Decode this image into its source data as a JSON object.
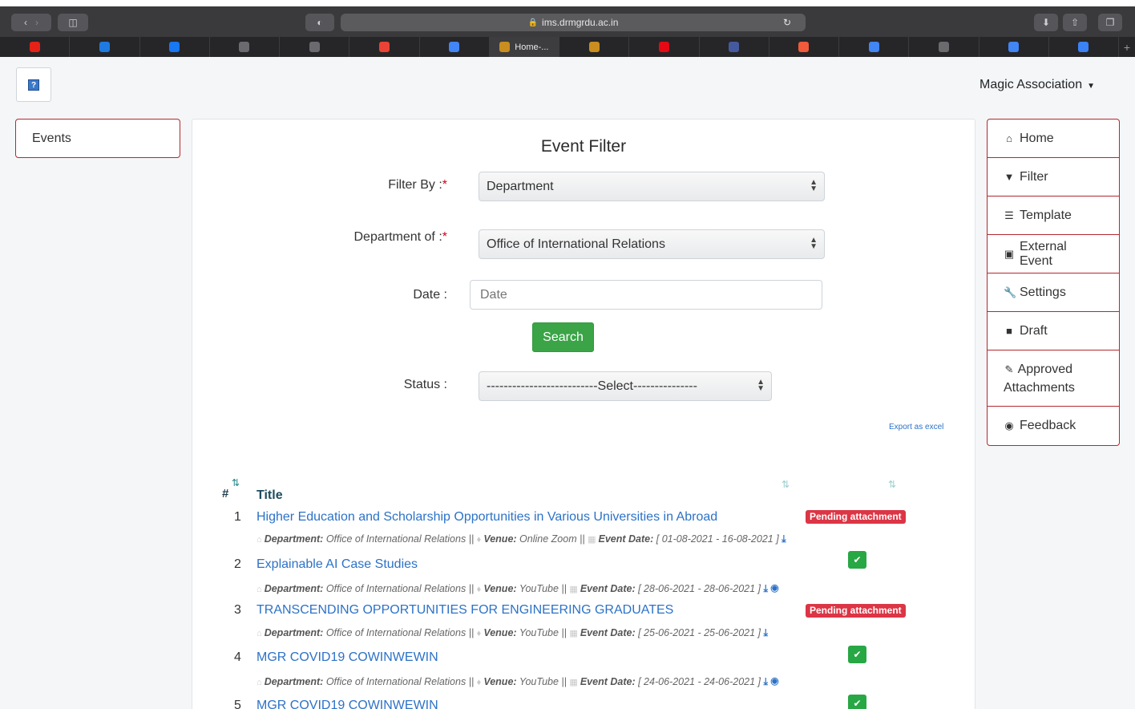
{
  "browser": {
    "url": "ims.drmgrdu.ac.in",
    "active_tab": "Home-...",
    "tabs": [
      {
        "icon": "youtube-icon",
        "color": "#e62117"
      },
      {
        "icon": "media-player-icon",
        "color": "#1f7ae0"
      },
      {
        "icon": "facebook-icon",
        "color": "#1877f2"
      },
      {
        "icon": "g-letter-icon",
        "color": "#6b6b6f"
      },
      {
        "icon": "s-letter-icon",
        "color": "#6b6b6f"
      },
      {
        "icon": "gmail-icon",
        "color": "#ea4335"
      },
      {
        "icon": "calendar-icon",
        "color": "#4285f4"
      },
      {
        "icon": "site-logo-icon",
        "color": "#c98e1f",
        "active": true
      },
      {
        "icon": "site-logo-icon",
        "color": "#c98e1f"
      },
      {
        "icon": "netflix-icon",
        "color": "#e50914"
      },
      {
        "icon": "translate-icon",
        "color": "#455a9e"
      },
      {
        "icon": "signal-icon",
        "color": "#f15a3a"
      },
      {
        "icon": "calendar-icon",
        "color": "#4285f4"
      },
      {
        "icon": "g-letter-icon",
        "color": "#6b6b6f"
      },
      {
        "icon": "calendar-icon",
        "color": "#4285f4"
      },
      {
        "icon": "bot-icon",
        "color": "#3b82f6"
      }
    ]
  },
  "header": {
    "user_menu": "Magic Association"
  },
  "left_nav": {
    "events_label": "Events"
  },
  "filter": {
    "title": "Event Filter",
    "filter_by_label": "Filter By :",
    "filter_by_value": "Department",
    "department_label": "Department of :",
    "department_value": "Office of International Relations",
    "date_label": "Date :",
    "date_placeholder": "Date",
    "search_label": "Search",
    "status_label": "Status :",
    "status_value": "--------------------------Select---------------",
    "required_mark": "*",
    "export_label": "Export as excel"
  },
  "table": {
    "hash_header": "#",
    "title_header": "Title",
    "meta_labels": {
      "department": "Department:",
      "venue": "Venue:",
      "event_date": "Event Date:"
    },
    "rows": [
      {
        "num": "1",
        "title": "Higher Education and Scholarship Opportunities in Various Universities in Abroad",
        "department": "Office of International Relations",
        "venue": "Online Zoom",
        "dates": "[ 01-08-2021 - 16-08-2021 ]",
        "status": "Pending attachment",
        "status_type": "pending"
      },
      {
        "num": "2",
        "title": "Explainable AI Case Studies",
        "department": "Office of International Relations",
        "venue": "YouTube",
        "dates": "[ 28-06-2021 - 28-06-2021 ]",
        "status": "",
        "status_type": "approved"
      },
      {
        "num": "3",
        "title": "TRANSCENDING OPPORTUNITIES FOR ENGINEERING GRADUATES",
        "department": "Office of International Relations",
        "venue": "YouTube",
        "dates": "[ 25-06-2021 - 25-06-2021 ]",
        "status": "Pending attachment",
        "status_type": "pending"
      },
      {
        "num": "4",
        "title": "MGR COVID19 COWINWEWIN",
        "department": "Office of International Relations",
        "venue": "YouTube",
        "dates": "[ 24-06-2021 - 24-06-2021 ]",
        "status": "",
        "status_type": "approved"
      },
      {
        "num": "5",
        "title": "MGR COVID19 COWINWEWIN",
        "status": "",
        "status_type": "approved"
      }
    ]
  },
  "right_nav": {
    "home": "Home",
    "filter": "Filter",
    "template": "Template",
    "external_event": "External Event",
    "settings": "Settings",
    "draft": "Draft",
    "approved_attachments": "Approved Attachments",
    "feedback": "Feedback"
  },
  "colors": {
    "accent_border": "#b4282e",
    "link": "#2c72c7",
    "success": "#28a745",
    "danger": "#dc3545"
  }
}
